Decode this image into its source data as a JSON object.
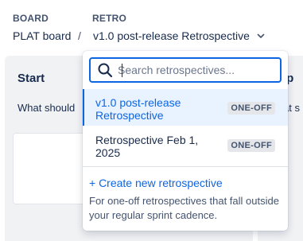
{
  "breadcrumb": {
    "board_label": "BOARD",
    "retro_label": "RETRO",
    "board_name": "PLAT board",
    "separator": "/",
    "current_retro": "v1.0 post-release Retrospective"
  },
  "board": {
    "columns": [
      {
        "title": "Start",
        "prompt": "What should"
      },
      {
        "title": "op",
        "prompt": "at s"
      }
    ]
  },
  "dropdown": {
    "search": {
      "placeholder": "Search retrospectives...",
      "value": ""
    },
    "options": [
      {
        "label": "v1.0 post-release\nRetrospective",
        "badge": "ONE-OFF",
        "selected": true
      },
      {
        "label": "Retrospective Feb 1,\n2025",
        "badge": "ONE-OFF",
        "selected": false
      }
    ],
    "create_label": "+ Create new retrospective",
    "create_help": "For one-off retrospectives that fall outside your regular sprint cadence."
  },
  "colors": {
    "accent": "#0c66e4",
    "selected_bg": "#e9f2ff",
    "text": "#172b4d",
    "subtle_text": "#44546f"
  }
}
